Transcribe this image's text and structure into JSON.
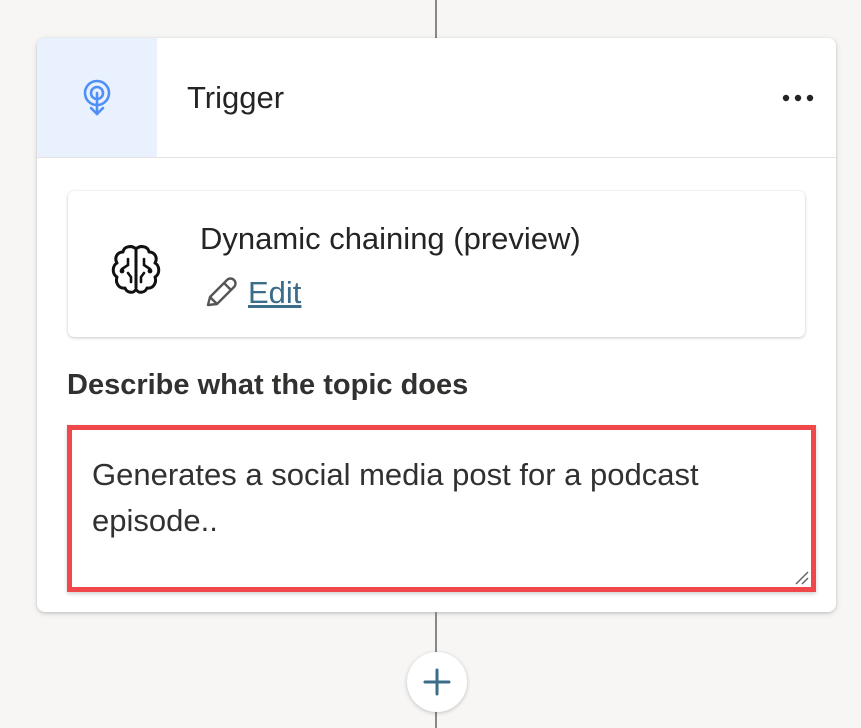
{
  "trigger_node": {
    "title": "Trigger",
    "more_icon": "more-horizontal-icon",
    "header_icon": "trigger-icon",
    "accent_color": "#e8f1fd"
  },
  "trigger_type": {
    "label": "Dynamic chaining (preview)",
    "icon": "brain-icon",
    "edit_label": "Edit",
    "edit_icon": "pencil-icon",
    "link_color": "#3b6c8a"
  },
  "description": {
    "label": "Describe what the topic does",
    "value": "Generates a social media post for a podcast episode..",
    "highlight_color": "#f0474a"
  },
  "add_node": {
    "icon": "plus-icon"
  }
}
